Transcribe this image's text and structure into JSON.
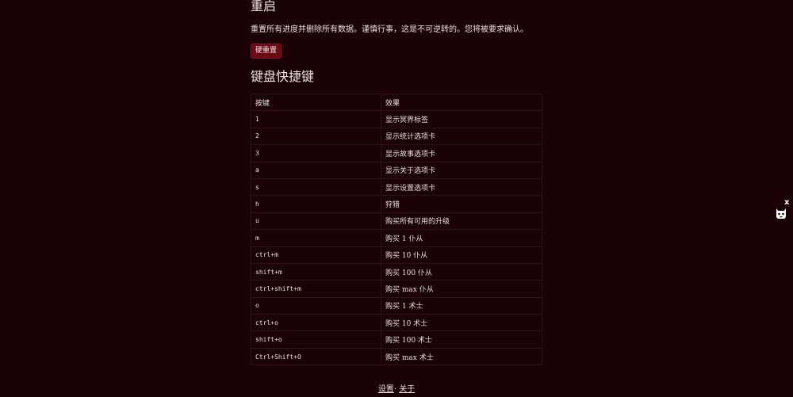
{
  "reset": {
    "title": "重启",
    "description": "重置所有进度并删除所有数据。谨慎行事，这是不可逆转的。您将被要求确认。",
    "button_label": "硬重置"
  },
  "shortcuts": {
    "title": "键盘快捷键",
    "headers": {
      "key": "按键",
      "effect": "效果"
    },
    "rows": [
      {
        "key": "1",
        "effect": "显示冥界标签"
      },
      {
        "key": "2",
        "effect": "显示统计选项卡"
      },
      {
        "key": "3",
        "effect": "显示故事选项卡"
      },
      {
        "key": "a",
        "effect": "显示关于选项卡"
      },
      {
        "key": "s",
        "effect": "显示设置选项卡"
      },
      {
        "key": "h",
        "effect": "狩猎"
      },
      {
        "key": "u",
        "effect": "购买所有可用的升级"
      },
      {
        "key": "m",
        "effect": "购买 1 仆从"
      },
      {
        "key": "ctrl+m",
        "effect": "购买 10 仆从"
      },
      {
        "key": "shift+m",
        "effect": "购买 100 仆从"
      },
      {
        "key": "ctrl+shift+m",
        "effect": "购买 max 仆从"
      },
      {
        "key": "o",
        "effect": "购买 1 术士"
      },
      {
        "key": "ctrl+o",
        "effect": "购买 10 术士"
      },
      {
        "key": "shift+o",
        "effect": "购买 100 术士"
      },
      {
        "key": "Ctrl+Shift+O",
        "effect": "购买 max 术士"
      }
    ]
  },
  "footer": {
    "settings": "设置",
    "separator": "·",
    "about": "关于"
  },
  "side_widget": {
    "close": "x",
    "icon": "cat-face-icon"
  }
}
